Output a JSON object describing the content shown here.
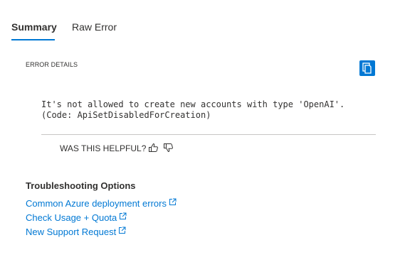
{
  "tabs": [
    {
      "label": "Summary",
      "active": true
    },
    {
      "label": "Raw Error",
      "active": false
    }
  ],
  "error_details": {
    "label": "ERROR DETAILS",
    "copy_icon": "copy-icon",
    "message_line1": "It's not allowed to create new accounts with type 'OpenAI'.",
    "message_line2": "(Code: ApiSetDisabledForCreation)"
  },
  "feedback": {
    "label": "WAS THIS HELPFUL?",
    "up_icon": "thumbs-up-icon",
    "down_icon": "thumbs-down-icon"
  },
  "troubleshooting": {
    "title": "Troubleshooting Options",
    "links": [
      {
        "label": "Common Azure deployment errors",
        "icon": "external-link-icon"
      },
      {
        "label": "Check Usage + Quota",
        "icon": "external-link-icon"
      },
      {
        "label": "New Support Request",
        "icon": "external-link-icon"
      }
    ]
  },
  "colors": {
    "accent": "#0078d4",
    "text": "#323130",
    "divider": "#c8c6c4"
  }
}
